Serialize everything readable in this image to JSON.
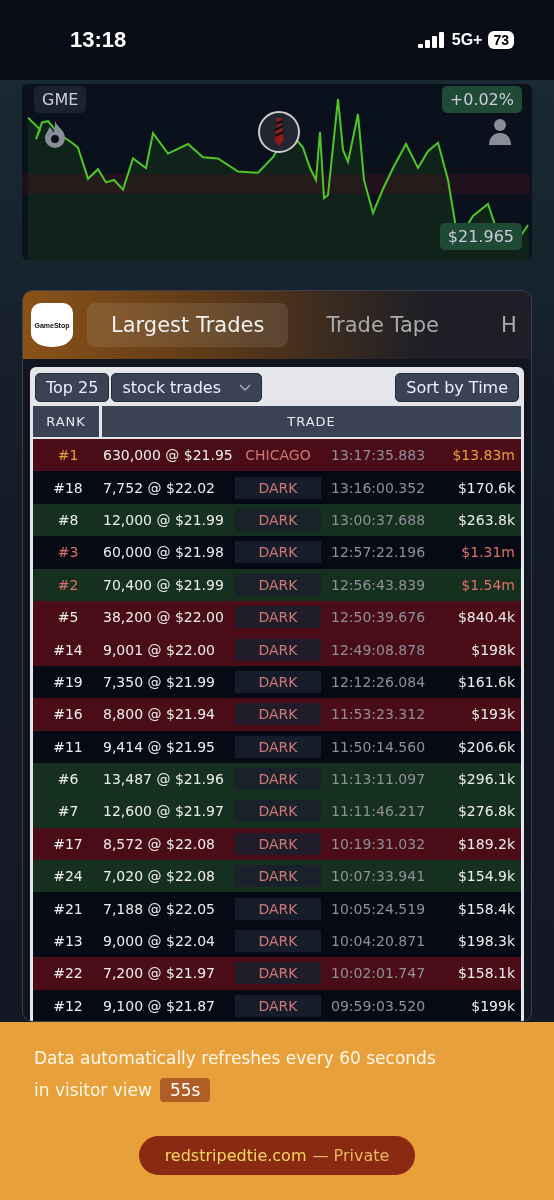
{
  "status_bar": {
    "time": "13:18",
    "network": "5G+",
    "battery": "73"
  },
  "chart": {
    "ticker": "GME",
    "change": "+0.02%",
    "price": "$21.965"
  },
  "card": {
    "logo_text": "GameStop",
    "tabs": [
      {
        "label": "Largest Trades",
        "selected": true
      },
      {
        "label": "Trade Tape",
        "selected": false
      },
      {
        "label": "H",
        "selected": false
      }
    ],
    "controls": {
      "top": "Top 25",
      "filter": "stock trades",
      "sort": "Sort by Time"
    },
    "table": {
      "columns": [
        "RANK",
        "TRADE"
      ],
      "rows": [
        {
          "rank": "#1",
          "trade": "630,000 @ $21.95",
          "venue": {
            "text": "CHICAGO",
            "boxed": false
          },
          "time": "13:17:35.883",
          "value": "$13.83m",
          "color": "#4a0d18",
          "highlight": {
            "color": "#e8a03c"
          }
        },
        {
          "rank": "#18",
          "trade": "7,752 @ $22.02",
          "venue": {
            "text": "DARK",
            "boxed": true
          },
          "time": "13:16:00.352",
          "value": "$170.6k",
          "color": "#060a14"
        },
        {
          "rank": "#8",
          "trade": "12,000 @ $21.99",
          "venue": {
            "text": "DARK",
            "boxed": true
          },
          "time": "13:00:37.688",
          "value": "$263.8k",
          "color": "#16301f"
        },
        {
          "rank": "#3",
          "trade": "60,000 @ $21.98",
          "venue": {
            "text": "DARK",
            "boxed": true
          },
          "time": "12:57:22.196",
          "value": "$1.31m",
          "color": "#060a14",
          "highlight": {
            "color": "#e0706a"
          }
        },
        {
          "rank": "#2",
          "trade": "70,400 @ $21.99",
          "venue": {
            "text": "DARK",
            "boxed": true
          },
          "time": "12:56:43.839",
          "value": "$1.54m",
          "color": "#16301f",
          "highlight": {
            "color": "#e0706a"
          }
        },
        {
          "rank": "#5",
          "trade": "38,200 @ $22.00",
          "venue": {
            "text": "DARK",
            "boxed": true
          },
          "time": "12:50:39.676",
          "value": "$840.4k",
          "color": "#4a0d18"
        },
        {
          "rank": "#14",
          "trade": "9,001 @ $22.00",
          "venue": {
            "text": "DARK",
            "boxed": true
          },
          "time": "12:49:08.878",
          "value": "$198k",
          "color": "#4a0d18"
        },
        {
          "rank": "#19",
          "trade": "7,350 @ $21.99",
          "venue": {
            "text": "DARK",
            "boxed": true
          },
          "time": "12:12:26.084",
          "value": "$161.6k",
          "color": "#060a14"
        },
        {
          "rank": "#16",
          "trade": "8,800 @ $21.94",
          "venue": {
            "text": "DARK",
            "boxed": true
          },
          "time": "11:53:23.312",
          "value": "$193k",
          "color": "#4a0d18"
        },
        {
          "rank": "#11",
          "trade": "9,414 @ $21.95",
          "venue": {
            "text": "DARK",
            "boxed": true
          },
          "time": "11:50:14.560",
          "value": "$206.6k",
          "color": "#060a14"
        },
        {
          "rank": "#6",
          "trade": "13,487 @ $21.96",
          "venue": {
            "text": "DARK",
            "boxed": true
          },
          "time": "11:13:11.097",
          "value": "$296.1k",
          "color": "#16301f"
        },
        {
          "rank": "#7",
          "trade": "12,600 @ $21.97",
          "venue": {
            "text": "DARK",
            "boxed": true
          },
          "time": "11:11:46.217",
          "value": "$276.8k",
          "color": "#16301f"
        },
        {
          "rank": "#17",
          "trade": "8,572 @ $22.08",
          "venue": {
            "text": "DARK",
            "boxed": true
          },
          "time": "10:19:31.032",
          "value": "$189.2k",
          "color": "#4a0d18"
        },
        {
          "rank": "#24",
          "trade": "7,020 @ $22.08",
          "venue": {
            "text": "DARK",
            "boxed": true
          },
          "time": "10:07:33.941",
          "value": "$154.9k",
          "color": "#16301f"
        },
        {
          "rank": "#21",
          "trade": "7,188 @ $22.05",
          "venue": {
            "text": "DARK",
            "boxed": true
          },
          "time": "10:05:24.519",
          "value": "$158.4k",
          "color": "#060a14"
        },
        {
          "rank": "#13",
          "trade": "9,000 @ $22.04",
          "venue": {
            "text": "DARK",
            "boxed": true
          },
          "time": "10:04:20.871",
          "value": "$198.3k",
          "color": "#060a14"
        },
        {
          "rank": "#22",
          "trade": "7,200 @ $21.97",
          "venue": {
            "text": "DARK",
            "boxed": true
          },
          "time": "10:02:01.747",
          "value": "$158.1k",
          "color": "#4a0d18"
        },
        {
          "rank": "#12",
          "trade": "9,100 @ $21.87",
          "venue": {
            "text": "DARK",
            "boxed": true
          },
          "time": "09:59:03.520",
          "value": "$199k",
          "color": "#060a14"
        }
      ]
    }
  },
  "footer": {
    "message_line1": "Data automatically refreshes every 60 seconds",
    "message_line2": "in visitor view",
    "countdown": "55s",
    "site": "redstripedtie.com",
    "site_note": "— Private"
  }
}
